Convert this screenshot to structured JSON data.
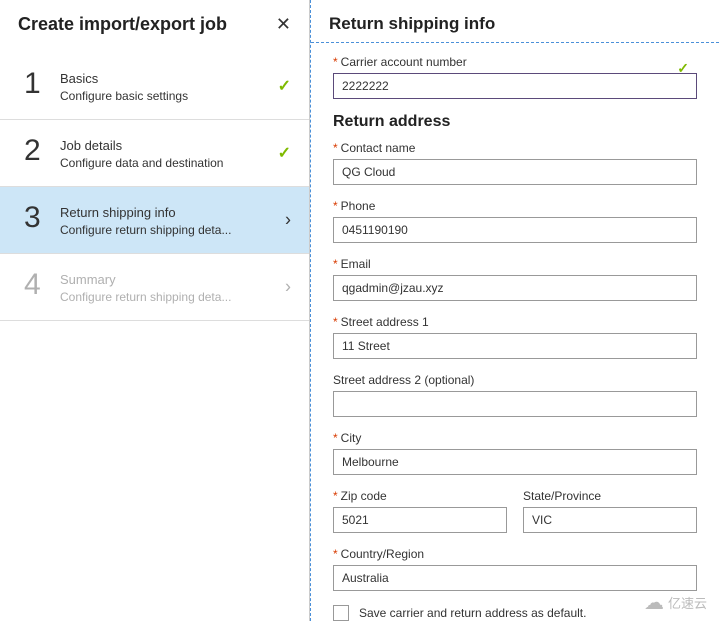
{
  "leftPanel": {
    "title": "Create import/export job",
    "steps": [
      {
        "num": "1",
        "title": "Basics",
        "sub": "Configure basic settings",
        "state": "done"
      },
      {
        "num": "2",
        "title": "Job details",
        "sub": "Configure data and destination",
        "state": "done"
      },
      {
        "num": "3",
        "title": "Return shipping info",
        "sub": "Configure return shipping deta...",
        "state": "current"
      },
      {
        "num": "4",
        "title": "Summary",
        "sub": "Configure return shipping deta...",
        "state": "disabled"
      }
    ]
  },
  "rightPanel": {
    "title": "Return shipping info",
    "sectionTitle": "Return address",
    "fields": {
      "carrier": {
        "label": "Carrier account number",
        "value": "2222222"
      },
      "contact": {
        "label": "Contact name",
        "value": "QG Cloud"
      },
      "phone": {
        "label": "Phone",
        "value": "0451190190"
      },
      "email": {
        "label": "Email",
        "value": "qgadmin@jzau.xyz"
      },
      "street1": {
        "label": "Street address 1",
        "value": "11 Street"
      },
      "street2": {
        "label": "Street address 2 (optional)",
        "value": ""
      },
      "city": {
        "label": "City",
        "value": "Melbourne"
      },
      "zip": {
        "label": "Zip code",
        "value": "5021"
      },
      "state": {
        "label": "State/Province",
        "value": "VIC"
      },
      "country": {
        "label": "Country/Region",
        "value": "Australia"
      }
    },
    "checkboxLabel": "Save carrier and return address as default."
  },
  "watermark": "亿速云"
}
